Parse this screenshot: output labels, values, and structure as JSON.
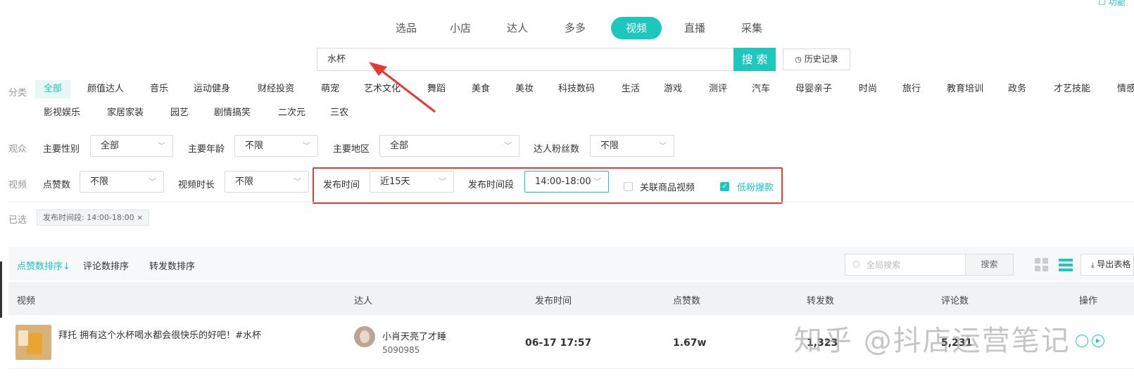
{
  "corner": {
    "label": "功能"
  },
  "tabs": [
    {
      "label": "选品",
      "active": false
    },
    {
      "label": "小店",
      "active": false
    },
    {
      "label": "达人",
      "active": false
    },
    {
      "label": "多多",
      "active": false
    },
    {
      "label": "视频",
      "active": true
    },
    {
      "label": "直播",
      "active": false
    },
    {
      "label": "采集",
      "active": false
    }
  ],
  "search": {
    "value": "水杯",
    "button": "搜 索",
    "history": "历史记录"
  },
  "category": {
    "label": "分类",
    "row1": [
      "全部",
      "颜值达人",
      "音乐",
      "运动健身",
      "财经投资",
      "萌宠",
      "艺术文化",
      "舞蹈",
      "美食",
      "美妆",
      "科技数码",
      "生活",
      "游戏",
      "测评",
      "汽车",
      "母婴亲子",
      "时尚",
      "旅行",
      "教育培训",
      "政务",
      "才艺技能",
      "情感"
    ],
    "row2": [
      "影视娱乐",
      "家居家装",
      "园艺",
      "剧情搞笑",
      "二次元",
      "三农"
    ]
  },
  "audience": {
    "label": "观众",
    "gender_label": "主要性别",
    "gender_value": "全部",
    "age_label": "主要年龄",
    "age_value": "不限",
    "region_label": "主要地区",
    "region_value": "全部",
    "fans_label": "达人粉丝数",
    "fans_value": "不限"
  },
  "video": {
    "label": "视频",
    "likes_label": "点赞数",
    "likes_value": "不限",
    "duration_label": "视频时长",
    "duration_value": "不限",
    "time_label": "发布时间",
    "time_value": "近15天",
    "period_label": "发布时间段",
    "period_value": "14:00-18:00",
    "related_label": "关联商品视频",
    "lowfan_label": "低粉爆款"
  },
  "selected": {
    "label": "已选",
    "chip": "发布时间段: 14:00-18:00"
  },
  "toolbar": {
    "sort_likes": "点赞数排序↓",
    "sort_comments": "评论数排序",
    "sort_shares": "转发数排序",
    "search_placeholder": "全局搜索",
    "search_button": "搜索",
    "export": "导出表格"
  },
  "table": {
    "headers": [
      "视频",
      "达人",
      "发布时间",
      "点赞数",
      "转发数",
      "评论数",
      "操作"
    ],
    "rows": [
      {
        "title": "拜托 拥有这个水杯喝水都会很快乐的好吧！#水杯",
        "author": "小肖天亮了才睡",
        "author_id": "5090985",
        "time": "06-17 17:57",
        "likes": "1.67w",
        "shares": "1,323",
        "comments": "5,231"
      }
    ]
  },
  "watermark": "知乎 @抖店运营笔记",
  "colors": {
    "accent": "#1cc7be",
    "highlight_box": "#e53935",
    "arrow": "#e53935"
  }
}
